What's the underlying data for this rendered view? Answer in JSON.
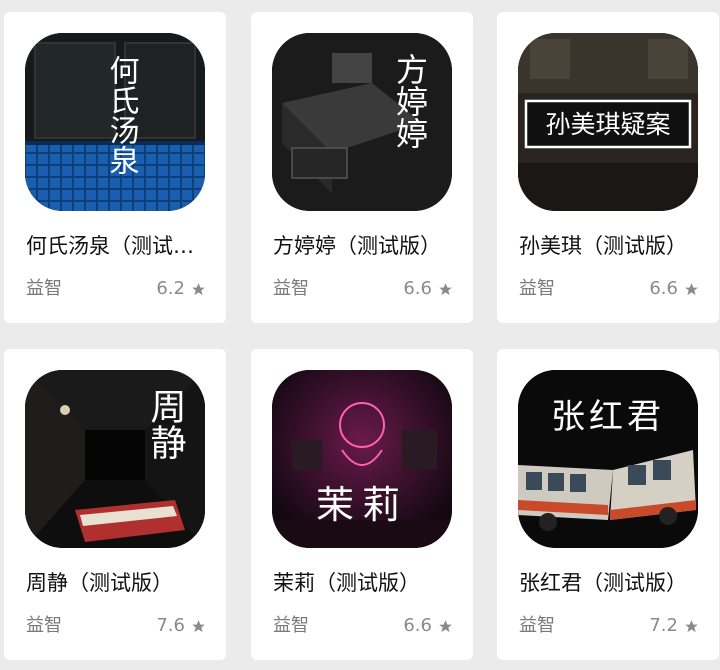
{
  "games": [
    {
      "title": "何氏汤泉（测试版）",
      "icon_text": "何氏汤泉",
      "category": "益智",
      "rating": "6.2",
      "icon_name": "he-shi-tang-quan-game-icon"
    },
    {
      "title": "方婷婷（测试版）",
      "icon_text": "方婷婷",
      "category": "益智",
      "rating": "6.6",
      "icon_name": "fang-ting-ting-game-icon"
    },
    {
      "title": "孙美琪（测试版）",
      "icon_text": "孙美琪疑案",
      "category": "益智",
      "rating": "6.6",
      "icon_name": "sun-mei-qi-game-icon"
    },
    {
      "title": "周静（测试版）",
      "icon_text": "周静",
      "category": "益智",
      "rating": "7.6",
      "icon_name": "zhou-jing-game-icon"
    },
    {
      "title": "茉莉（测试版）",
      "icon_text": "茉莉",
      "category": "益智",
      "rating": "6.6",
      "icon_name": "mo-li-game-icon"
    },
    {
      "title": "张红君（测试版）",
      "icon_text": "张红君",
      "category": "益智",
      "rating": "7.2",
      "icon_name": "zhang-hong-jun-game-icon"
    }
  ],
  "colors": {
    "card_bg": "#ffffff",
    "page_bg": "#ebebeb",
    "star": "#8a8a8a"
  }
}
